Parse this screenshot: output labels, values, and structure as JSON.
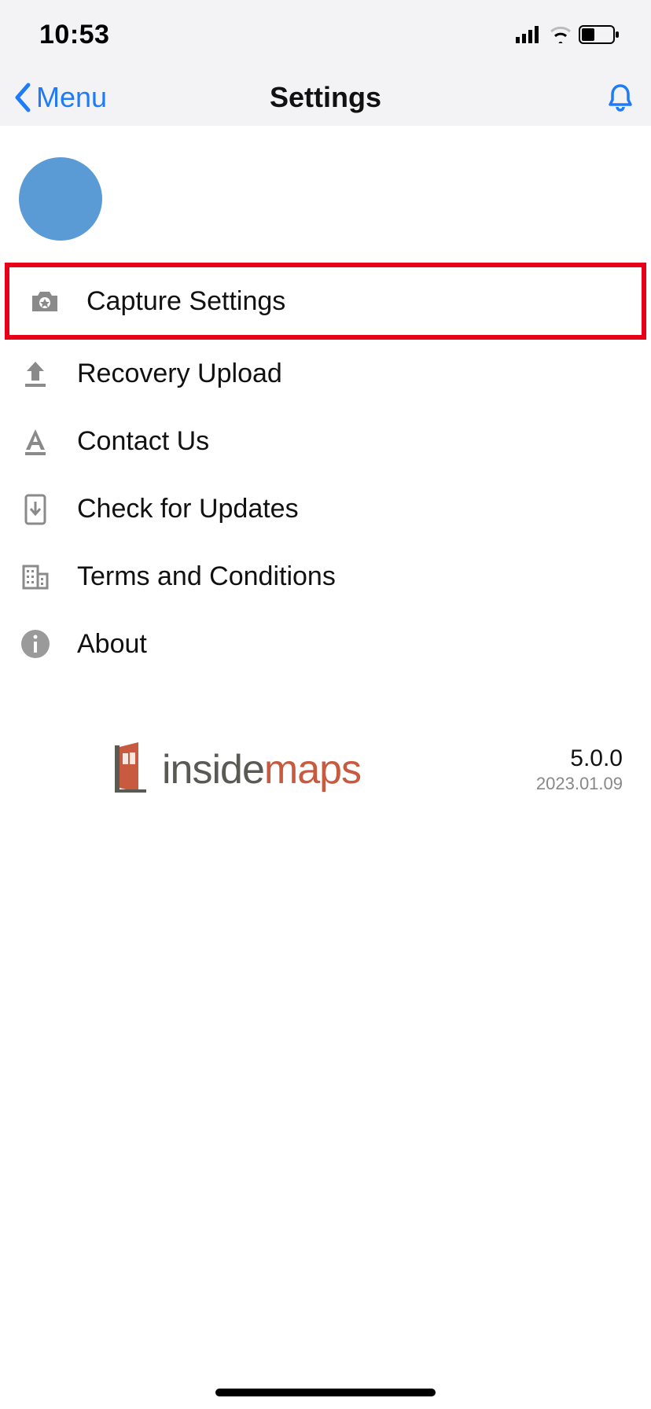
{
  "statusbar": {
    "time": "10:53"
  },
  "navbar": {
    "back_label": "Menu",
    "title": "Settings"
  },
  "list": {
    "items": [
      {
        "label": "Capture Settings",
        "icon": "camera-icon",
        "highlighted": true
      },
      {
        "label": "Recovery Upload",
        "icon": "upload-icon"
      },
      {
        "label": "Contact Us",
        "icon": "text-a-icon"
      },
      {
        "label": "Check for Updates",
        "icon": "download-device-icon"
      },
      {
        "label": "Terms and Conditions",
        "icon": "building-icon"
      },
      {
        "label": "About",
        "icon": "info-icon"
      }
    ]
  },
  "footer": {
    "brand_part1": "inside",
    "brand_part2": "maps",
    "version": "5.0.0",
    "date": "2023.01.09"
  }
}
